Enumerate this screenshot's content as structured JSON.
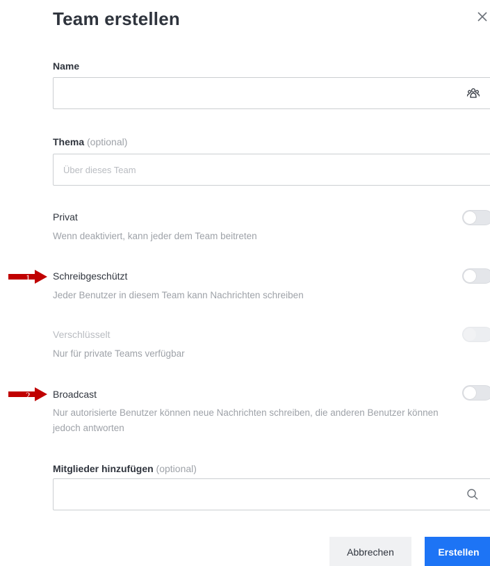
{
  "dialog": {
    "title": "Team erstellen",
    "close_icon": "close-icon"
  },
  "name_field": {
    "label": "Name",
    "value": "",
    "placeholder": "",
    "icon": "team-icon"
  },
  "topic_field": {
    "label": "Thema",
    "optional": "(optional)",
    "value": "",
    "placeholder": "Über dieses Team"
  },
  "options": [
    {
      "title": "Privat",
      "description": "Wenn deaktiviert, kann jeder dem Team beitreten",
      "enabled": false,
      "disabled": false
    },
    {
      "title": "Schreibgeschützt",
      "description": "Jeder Benutzer in diesem Team kann Nachrichten schreiben",
      "enabled": false,
      "disabled": false
    },
    {
      "title": "Verschlüsselt",
      "description": "Nur für private Teams verfügbar",
      "enabled": false,
      "disabled": true
    },
    {
      "title": "Broadcast",
      "description": "Nur autorisierte Benutzer können neue Nachrichten schreiben, die anderen Benutzer können jedoch antworten",
      "enabled": false,
      "disabled": false
    }
  ],
  "members_field": {
    "label": "Mitglieder hinzufügen",
    "optional": "(optional)",
    "value": "",
    "placeholder": "",
    "icon": "search-icon"
  },
  "annotations": [
    {
      "number": "1",
      "color": "#c00000"
    },
    {
      "number": "2",
      "color": "#c00000"
    }
  ],
  "footer": {
    "cancel_label": "Abbrechen",
    "create_label": "Erstellen"
  },
  "colors": {
    "primary": "#1d74f5",
    "arrow": "#c00000"
  }
}
